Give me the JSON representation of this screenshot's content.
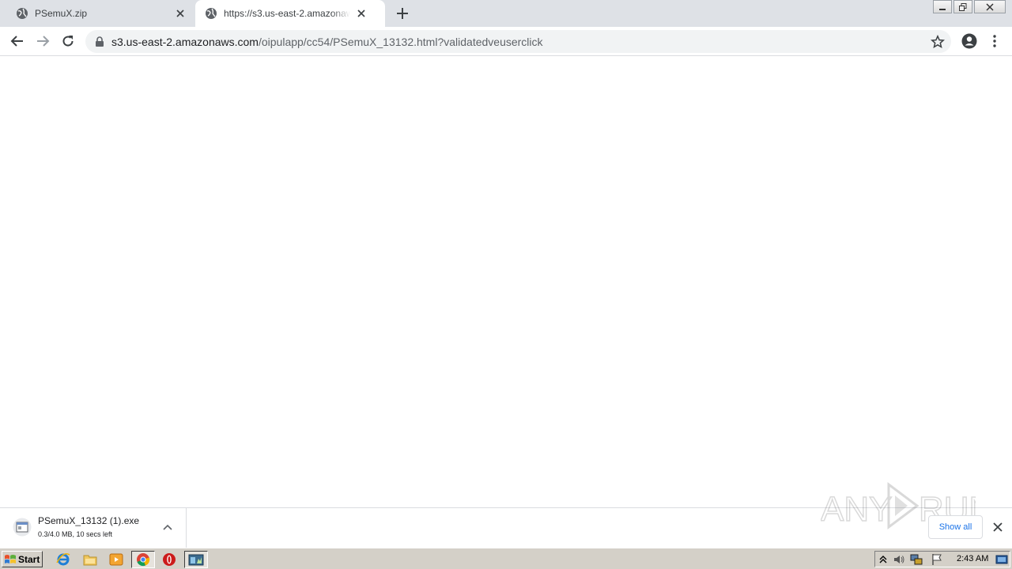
{
  "browser": {
    "tabs": [
      {
        "title": "PSemuX.zip",
        "active": false
      },
      {
        "title": "https://s3.us-east-2.amazonaws.com/oipulapp/cc54/PSemuX_13132.html?validatedveuserclick",
        "active": true
      }
    ],
    "address_bar": {
      "host": "s3.us-east-2.amazonaws.com",
      "path": "/oipulapp/cc54/PSemuX_13132.html?validatedveuserclick"
    }
  },
  "download_bar": {
    "item": {
      "filename": "PSemuX_13132 (1).exe",
      "status": "0.3/4.0 MB, 10 secs left"
    },
    "show_all_label": "Show all"
  },
  "watermark": {
    "text": "ANY RUN"
  },
  "taskbar": {
    "start_label": "Start",
    "clock": "2:43 AM"
  }
}
